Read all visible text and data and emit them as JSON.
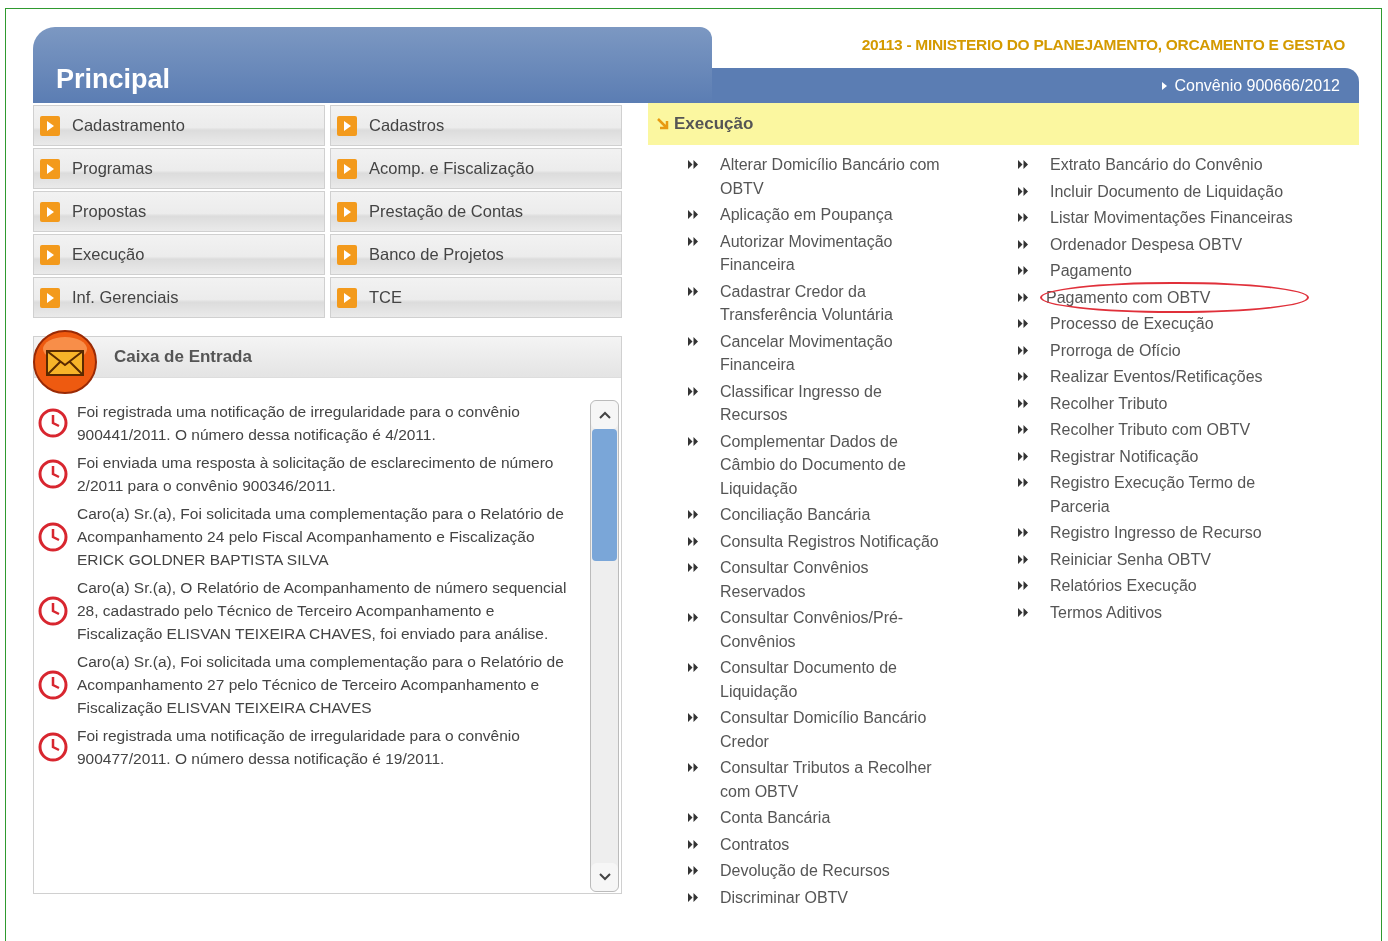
{
  "header": {
    "title": "Principal",
    "organ": "20113 - MINISTERIO DO PLANEJAMENTO, ORCAMENTO E GESTAO",
    "convenio": "Convênio 900666/2012"
  },
  "menu": [
    {
      "label": "Cadastramento",
      "selected": false
    },
    {
      "label": "Cadastros",
      "selected": false
    },
    {
      "label": "Programas",
      "selected": false
    },
    {
      "label": "Acomp. e Fiscalização",
      "selected": false
    },
    {
      "label": "Propostas",
      "selected": false
    },
    {
      "label": "Prestação de Contas",
      "selected": false
    },
    {
      "label": "Execução",
      "selected": false
    },
    {
      "label": "Banco de Projetos",
      "selected": false
    },
    {
      "label": "Inf. Gerenciais",
      "selected": false
    },
    {
      "label": "TCE",
      "selected": false
    }
  ],
  "inbox": {
    "title": "Caixa de Entrada",
    "messages": [
      "Foi registrada uma notificação de irregularidade para o convênio 900441/2011. O número dessa notificação é 4/2011.",
      "Foi enviada uma resposta à solicitação de esclarecimento de número 2/2011 para o convênio 900346/2011.",
      "Caro(a) Sr.(a), Foi solicitada uma complementação para o Relatório de Acompanhamento 24 pelo Fiscal Acompanhamento e Fiscalização ERICK GOLDNER BAPTISTA SILVA",
      "Caro(a) Sr.(a), O Relatório de Acompanhamento de número sequencial 28, cadastrado pelo Técnico de Terceiro Acompanhamento e Fiscalização ELISVAN TEIXEIRA CHAVES, foi enviado para análise.",
      "Caro(a) Sr.(a), Foi solicitada uma complementação para o Relatório de Acompanhamento 27 pelo Técnico de Terceiro Acompanhamento e Fiscalização ELISVAN TEIXEIRA CHAVES",
      "Foi registrada uma notificação de irregularidade para o convênio 900477/2011. O número dessa notificação é 19/2011."
    ]
  },
  "section": {
    "title": "Execução",
    "columns": [
      [
        {
          "label": "Alterar Domicílio Bancário com OBTV",
          "highlighted": false
        },
        {
          "label": "Aplicação em Poupança",
          "highlighted": false
        },
        {
          "label": "Autorizar Movimentação Financeira",
          "highlighted": false
        },
        {
          "label": "Cadastrar Credor da Transferência Voluntária",
          "highlighted": false
        },
        {
          "label": "Cancelar Movimentação Financeira",
          "highlighted": false
        },
        {
          "label": "Classificar Ingresso de Recursos",
          "highlighted": false
        },
        {
          "label": "Complementar Dados de Câmbio do Documento de Liquidação",
          "highlighted": false
        },
        {
          "label": "Conciliação Bancária",
          "highlighted": false
        },
        {
          "label": "Consulta Registros Notificação",
          "highlighted": false
        },
        {
          "label": "Consultar Convênios Reservados",
          "highlighted": false
        },
        {
          "label": "Consultar Convênios/Pré-Convênios",
          "highlighted": false
        },
        {
          "label": "Consultar Documento de Liquidação",
          "highlighted": false
        },
        {
          "label": "Consultar Domicílio Bancário Credor",
          "highlighted": false
        },
        {
          "label": "Consultar Tributos a Recolher com OBTV",
          "highlighted": false
        },
        {
          "label": "Conta Bancária",
          "highlighted": false
        },
        {
          "label": "Contratos",
          "highlighted": false
        },
        {
          "label": "Devolução de Recursos",
          "highlighted": false
        },
        {
          "label": "Discriminar OBTV",
          "highlighted": false
        }
      ],
      [
        {
          "label": "Extrato Bancário do Convênio",
          "highlighted": false
        },
        {
          "label": "Incluir Documento de Liquidação",
          "highlighted": false
        },
        {
          "label": "Listar Movimentações Financeiras",
          "highlighted": false
        },
        {
          "label": "Ordenador Despesa OBTV",
          "highlighted": false
        },
        {
          "label": "Pagamento",
          "highlighted": false
        },
        {
          "label": "Pagamento com OBTV",
          "highlighted": true
        },
        {
          "label": "Processo de Execução",
          "highlighted": false
        },
        {
          "label": "Prorroga de Ofício",
          "highlighted": false
        },
        {
          "label": "Realizar Eventos/Retificações",
          "highlighted": false
        },
        {
          "label": "Recolher Tributo",
          "highlighted": false
        },
        {
          "label": "Recolher Tributo com OBTV",
          "highlighted": false
        },
        {
          "label": "Registrar Notificação",
          "highlighted": false
        },
        {
          "label": "Registro Execução Termo de Parceria",
          "highlighted": false
        },
        {
          "label": "Registro Ingresso de Recurso",
          "highlighted": false
        },
        {
          "label": "Reiniciar Senha OBTV",
          "highlighted": false
        },
        {
          "label": "Relatórios Execução",
          "highlighted": false
        },
        {
          "label": "Termos Aditivos",
          "highlighted": false
        }
      ]
    ]
  }
}
